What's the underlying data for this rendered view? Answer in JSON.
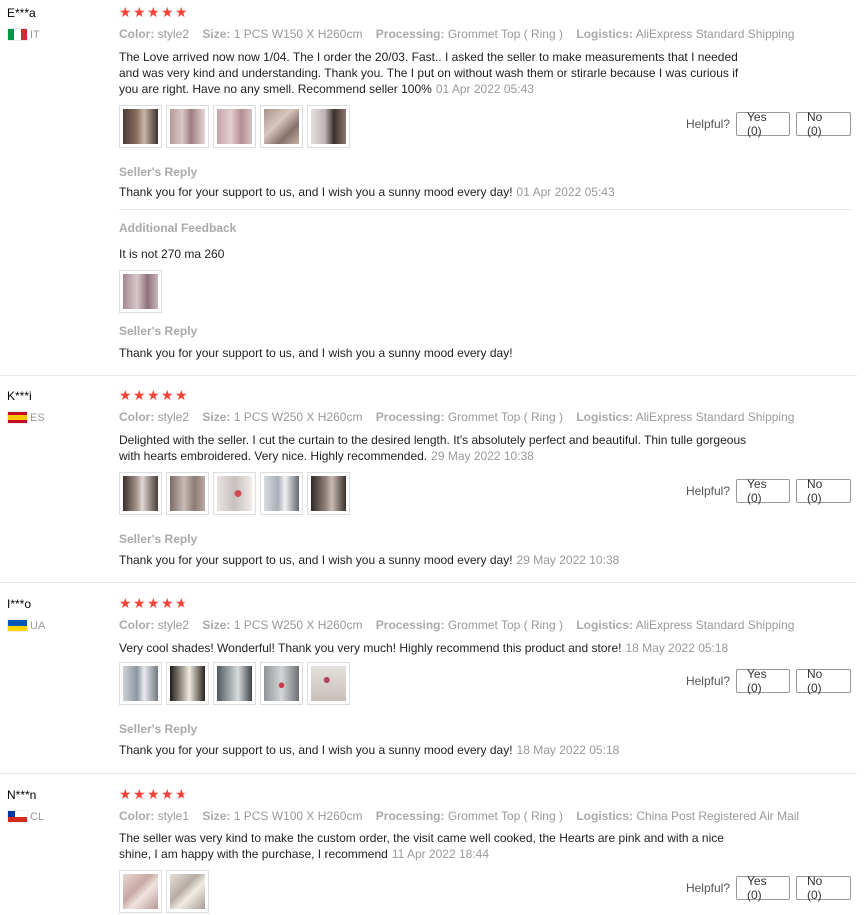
{
  "labels": {
    "color": "Color:",
    "size": "Size:",
    "processing": "Processing:",
    "logistics": "Logistics:",
    "helpful": "Helpful?",
    "yes": "Yes (0)",
    "no": "No (0)",
    "sellers_reply": "Seller's Reply",
    "additional_feedback": "Additional Feedback"
  },
  "reviews": [
    {
      "user": "E***a",
      "country": "IT",
      "rating": 5,
      "color": "style2",
      "size": "1 PCS W150 X H260cm",
      "processing": "Grommet Top ( Ring )",
      "logistics": "AliExpress Standard Shipping",
      "text": "The Love arrived now now 1/04. The I order the 20/03. Fast.. I asked the seller to make measurements that I needed and was very kind and understanding. Thank you. The I put on without wash them or stirarle because I was curious if you are right. Have no any smell. Recommend seller 100%",
      "date": "01 Apr 2022 05:43",
      "reply": "Thank you for your support to us, and I wish you a sunny mood every day!",
      "reply_date": "01 Apr 2022 05:43",
      "additional_text": "It is not 270 ma 260",
      "additional_reply": "Thank you for your support to us, and I wish you a sunny mood every day!"
    },
    {
      "user": "K***i",
      "country": "ES",
      "rating": 5,
      "color": "style2",
      "size": "1 PCS W250 X H260cm",
      "processing": "Grommet Top ( Ring )",
      "logistics": "AliExpress Standard Shipping",
      "text": "Delighted with the seller. I cut the curtain to the desired length. It's absolutely perfect and beautiful. Thin tulle gorgeous with hearts embroidered. Very nice. Highly recommended.",
      "date": "29 May 2022 10:38",
      "reply": "Thank you for your support to us, and I wish you a sunny mood every day!",
      "reply_date": "29 May 2022 10:38"
    },
    {
      "user": "I***o",
      "country": "UA",
      "rating": 4.5,
      "color": "style2",
      "size": "1 PCS W250 X H260cm",
      "processing": "Grommet Top ( Ring )",
      "logistics": "AliExpress Standard Shipping",
      "text": "Very cool shades! Wonderful! Thank you very much! Highly recommend this product and store!",
      "date": "18 May 2022 05:18",
      "reply": "Thank you for your support to us, and I wish you a sunny mood every day!",
      "reply_date": "18 May 2022 05:18"
    },
    {
      "user": "N***n",
      "country": "CL",
      "rating": 4.5,
      "color": "style1",
      "size": "1 PCS W100 X H260cm",
      "processing": "Grommet Top ( Ring )",
      "logistics": "China Post Registered Air Mail",
      "text": "The seller was very kind to make the custom order, the visit came well cooked, the Hearts are pink and with a nice shine, I am happy with the purchase, I recommend",
      "date": "11 Apr 2022 18:44"
    }
  ]
}
